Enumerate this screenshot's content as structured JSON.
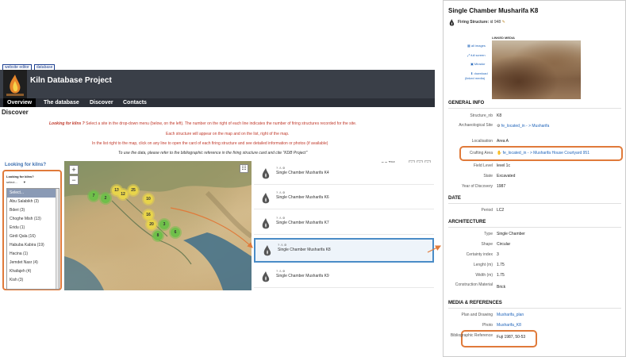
{
  "header": {
    "top_links": [
      "website editor",
      "database"
    ],
    "title": "Kiln Database Project",
    "nav": [
      "Overview",
      "The database",
      "Discover",
      "Contacts"
    ],
    "active_nav": "Overview",
    "page_heading": "Discover"
  },
  "instructions": {
    "label": "Looking for kilns ?",
    "line1": "Select a site in the drop-down menu (below, on the left). The number on the right of each line indicates the number of firing structures recorded for the site.",
    "line2": "Each structure will appear on the map and on the list, right of the map.",
    "line3": "In the list right to the map, click on any line to open the card of each firing structure and see detailed information or photos (if available)",
    "line4": "To use the data, please refer to the bibliographic reference in the firing structure card and cite \"KDB Project\""
  },
  "site_panel": {
    "outer_title": "Looking for kilns?",
    "inner_title": "Looking for kilns?",
    "select_value": "select...",
    "items": [
      "Select...",
      "Abu Salabikh (3)",
      "Bderi (3)",
      "Choghe Mish (13)",
      "Eridu (1)",
      "Girdi Qala (16)",
      "Habuba Kabira (19)",
      "Hacina (1)",
      "Jemdet Nasr (4)",
      "Khafajeh (4)",
      "Kish (3)"
    ]
  },
  "map": {
    "zoom_in": "+",
    "zoom_out": "−",
    "layers": "☷",
    "clusters": [
      {
        "label": "13",
        "color": "yellow"
      },
      {
        "label": "25",
        "color": "yellow"
      },
      {
        "label": "12",
        "color": "yellow"
      },
      {
        "label": "7",
        "color": "green"
      },
      {
        "label": "2",
        "color": "green"
      },
      {
        "label": "10",
        "color": "yellow"
      },
      {
        "label": "6",
        "color": "green"
      },
      {
        "label": "8",
        "color": "green"
      },
      {
        "label": "16",
        "color": "yellow"
      },
      {
        "label": "20",
        "color": "yellow"
      },
      {
        "label": "3",
        "color": "green"
      }
    ]
  },
  "results": {
    "count": "n = 234",
    "pages": [
      "1",
      "2",
      "3"
    ],
    "rows": [
      {
        "label": "Single Chamber Musharifa K4",
        "icons": "? ⚠ ⊘"
      },
      {
        "label": "Single Chamber Musharifa K6",
        "icons": "? ⚠ ⊘"
      },
      {
        "label": "Single Chamber Musharifa K7",
        "icons": "? ⚠ ⊘"
      },
      {
        "label": "Single Chamber Musharifa K8",
        "icons": "? ⚠ ⊘"
      },
      {
        "label": "Single Chamber Musharifa K9",
        "icons": "? ⚠ ⊘"
      }
    ]
  },
  "card": {
    "title": "Single Chamber Musharifa K8",
    "firing_label": "Firing Structure:",
    "firing_value": "id 948",
    "linked_media_title": "LINKED MEDIA",
    "media_links": [
      "all images",
      "full screen",
      "Mirador",
      "download",
      "(linked media)"
    ],
    "general_info_title": "GENERAL INFO",
    "general_info": [
      {
        "label": "Structure_nb",
        "value": "K8",
        "link": false
      },
      {
        "label": "Archaeological Site",
        "value": "fe_located_in - > Musharifa",
        "link": true
      },
      {
        "label": "Localisation",
        "value": "Area A",
        "link": false
      },
      {
        "label": "Crafting Area",
        "value": "fe_located_in - > Musharifa House Courtyard 951",
        "link": true
      },
      {
        "label": "Field Level",
        "value": "level 1c",
        "link": false
      },
      {
        "label": "State",
        "value": "Excavated",
        "link": false
      },
      {
        "label": "Year of Discovery",
        "value": "1987",
        "link": false
      }
    ],
    "date_title": "DATE",
    "date": [
      {
        "label": "Period",
        "value": "LC2",
        "link": false
      }
    ],
    "architecture_title": "ARCHITECTURE",
    "architecture": [
      {
        "label": "Type",
        "value": "Single Chamber",
        "link": false
      },
      {
        "label": "Shape",
        "value": "Circular",
        "link": false
      },
      {
        "label": "Certainty index",
        "value": "3",
        "link": false
      },
      {
        "label": "Lenght (m)",
        "value": "1.75",
        "link": false
      },
      {
        "label": "Width (m)",
        "value": "1.75",
        "link": false
      },
      {
        "label": "Construction Material",
        "value": "Brick",
        "link": false
      }
    ],
    "media_title": "MEDIA & REFERENCES",
    "media": [
      {
        "label": "Plan and Drawing",
        "value": "Musharifa_plan",
        "link": true
      },
      {
        "label": "Photo",
        "value": "Musharifa_K8",
        "link": true
      },
      {
        "label": "Bibliographic Reference",
        "value": "Fuji 1987, 50-53",
        "link": false
      }
    ]
  },
  "colors": {
    "header_bg": "#3a3f48",
    "nav_bg": "#2c3038",
    "highlight": "#e07a3a",
    "link": "#2266bb",
    "instruction": "#c0392b"
  }
}
